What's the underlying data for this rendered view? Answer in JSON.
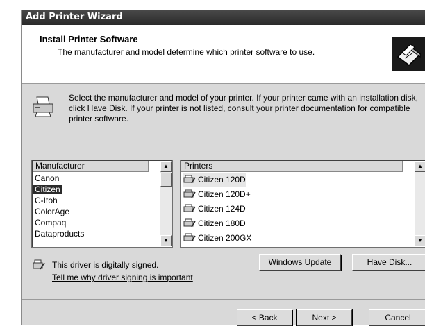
{
  "window": {
    "title": "Add Printer Wizard"
  },
  "header": {
    "title": "Install Printer Software",
    "subtitle": "The manufacturer and model determine which printer software to use."
  },
  "intro_text": "Select the manufacturer and model of your printer. If your printer came with an installation disk, click Have Disk. If your printer is not listed, consult your printer documentation for compatible printer software.",
  "manufacturers": {
    "header": "Manufacturer",
    "items": [
      "Canon",
      "Citizen",
      "C-Itoh",
      "ColorAge",
      "Compaq",
      "Dataproducts"
    ],
    "selected": "Citizen"
  },
  "printers": {
    "header": "Printers",
    "items": [
      "Citizen 120D",
      "Citizen 120D+",
      "Citizen 124D",
      "Citizen 180D",
      "Citizen 200GX"
    ],
    "selected": "Citizen 120D"
  },
  "driver": {
    "signed_text": "This driver is digitally signed.",
    "signing_link": "Tell me why driver signing is important"
  },
  "buttons": {
    "windows_update": "Windows Update",
    "have_disk": "Have Disk...",
    "back": "< Back",
    "next": "Next >",
    "cancel": "Cancel"
  },
  "icons": {
    "wizard": "printer-wizard-icon",
    "body": "printer-icon",
    "signed": "signed-driver-icon",
    "scroll_up": "scroll-up-arrow-icon",
    "scroll_down": "scroll-down-arrow-icon"
  }
}
